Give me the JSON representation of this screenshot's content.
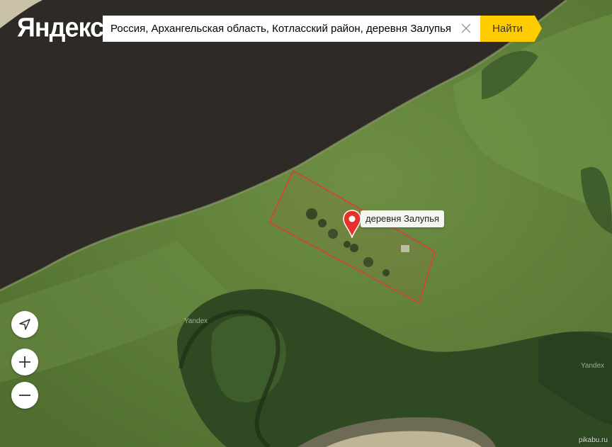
{
  "logo": {
    "text": "Яндекс"
  },
  "search": {
    "value": "Россия, Архангельская область, Котласский район, деревня Залупья",
    "button_label": "Найти"
  },
  "icons": {
    "clear": "close-icon",
    "locate": "navigation-arrow-icon",
    "zoom_in": "plus-icon",
    "zoom_out": "minus-icon",
    "placemark": "map-pin-icon"
  },
  "placemark": {
    "label": "деревня Залупья"
  },
  "watermarks": {
    "left": "Yandex",
    "right": "Yandex"
  },
  "credit": "pikabu.ru",
  "colors": {
    "search_button": "#ffcc00",
    "pin": "#e8302a",
    "boundary": "#e03a3a",
    "river": "#2e2a26",
    "meadow": "#5e7e3a",
    "forest": "#2f4a22"
  }
}
